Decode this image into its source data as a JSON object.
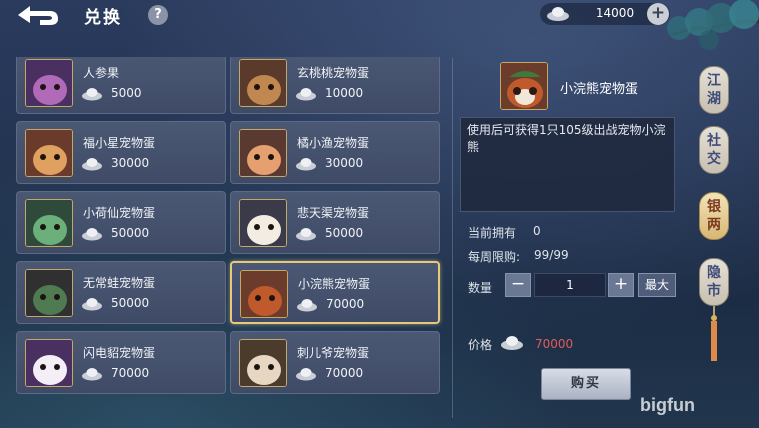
{
  "header": {
    "title": "兑换",
    "help_label": "?",
    "currency_amount": "14000",
    "add_label": "+"
  },
  "items": [
    {
      "name": "人参果",
      "price": "5000",
      "icon": "ginseng-fruit-icon"
    },
    {
      "name": "玄桃桃宠物蛋",
      "price": "10000",
      "icon": "monkey-pet-icon"
    },
    {
      "name": "福小星宠物蛋",
      "price": "30000",
      "icon": "fox-pet-icon"
    },
    {
      "name": "橘小渔宠物蛋",
      "price": "30000",
      "icon": "cat-pet-icon"
    },
    {
      "name": "小荷仙宠物蛋",
      "price": "50000",
      "icon": "frog-pet-icon"
    },
    {
      "name": "悲天渠宠物蛋",
      "price": "50000",
      "icon": "owl-pet-icon"
    },
    {
      "name": "无常蛙宠物蛋",
      "price": "50000",
      "icon": "toad-pet-icon"
    },
    {
      "name": "小浣熊宠物蛋",
      "price": "70000",
      "icon": "red-panda-pet-icon"
    },
    {
      "name": "闪电貂宠物蛋",
      "price": "70000",
      "icon": "ferret-pet-icon"
    },
    {
      "name": "刺儿爷宠物蛋",
      "price": "70000",
      "icon": "hedgehog-pet-icon"
    }
  ],
  "detail": {
    "name": "小浣熊宠物蛋",
    "description": "使用后可获得1只105级出战宠物小浣熊",
    "owned_label": "当前拥有",
    "owned_value": "0",
    "weekly_label": "每周限购:",
    "weekly_value": "99/99",
    "qty_label": "数量",
    "qty_minus": "−",
    "qty_value": "1",
    "qty_plus": "+",
    "max_label": "最大",
    "price_label": "价格",
    "price_value": "70000",
    "buy_label": "购买"
  },
  "side_tabs": [
    {
      "line1": "江",
      "line2": "湖"
    },
    {
      "line1": "社",
      "line2": "交"
    },
    {
      "line1": "银",
      "line2": "两"
    },
    {
      "line1": "隐",
      "line2": "市"
    }
  ],
  "watermark": "bigfun",
  "colors": {
    "price_red": "#e05b5b",
    "selected_border": "#e6c97d",
    "active_tab_text": "#7a3b1f"
  }
}
